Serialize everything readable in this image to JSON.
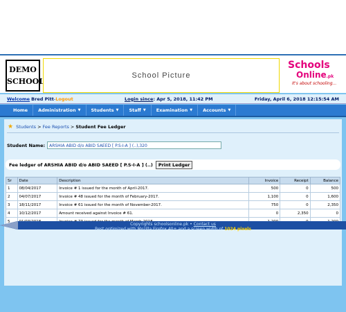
{
  "header": {
    "logo_line1": "DEMO",
    "logo_line2": "SCHOOL",
    "picture_label": "School Picture",
    "brand_schools": "Schools",
    "brand_online": "Online",
    "brand_pk": ".pk",
    "brand_tagline": "It's about schooling..."
  },
  "userbar": {
    "welcome": "Welcome",
    "user": "Bred Pitt",
    "sep": "-",
    "logout": "Logout",
    "login_since_label": "Login since",
    "login_since_value": ": Apr 5, 2018, 11:42 PM",
    "datetime": "Friday, April 6, 2018 12:15:54 AM"
  },
  "nav": [
    {
      "label": "Home",
      "caret": ""
    },
    {
      "label": "Administration",
      "caret": "▼"
    },
    {
      "label": "Students",
      "caret": "▼"
    },
    {
      "label": "Staff",
      "caret": "▼"
    },
    {
      "label": "Examination",
      "caret": "▼"
    },
    {
      "label": "Accounts",
      "caret": "▼"
    }
  ],
  "breadcrumb": {
    "items": [
      "Students",
      "Fee Reports"
    ],
    "separator": ">",
    "current": "Student Fee Ledger"
  },
  "student": {
    "label": "Student Name:",
    "value": "ARSHIA ABID d/o ABID SAEED [ P.S-I-A ] (..),320"
  },
  "ledger": {
    "title": "Fee ledger of ARSHIA ABID d/o ABID SAEED [ P.S-I-A ] (..)",
    "print_label": "Print Ledger",
    "columns": [
      "Sr",
      "Date",
      "Description",
      "Invoice",
      "Receipt",
      "Balance"
    ],
    "rows": [
      [
        "1",
        "08/04/2017",
        "Invoice # 1 issued for the month of April-2017.",
        "500",
        "0",
        "500"
      ],
      [
        "2",
        "04/07/2017",
        "Invoice # 48 issued for the month of February-2017.",
        "1,100",
        "0",
        "1,600"
      ],
      [
        "3",
        "18/11/2017",
        "Invoice # 61 issued for the month of November-2017.",
        "750",
        "0",
        "2,350"
      ],
      [
        "4",
        "10/12/2017",
        "Amount received against Invoice # 61.",
        "0",
        "2,350",
        "0"
      ],
      [
        "5",
        "01/03/2018",
        "Invoice # 73 issued for the month of March-2018.",
        "1,200",
        "0",
        "1,200"
      ]
    ]
  },
  "footer": {
    "copyright": "Copyrights schoolsonline.pk",
    "bullet": "•",
    "contact": "Contact us",
    "best_prefix": "Best optimized with Mozilla Firefox 40+ and a screen width of",
    "best_px": "1024 pixels"
  },
  "colors": {
    "page_bg": "#7ec4f0",
    "nav_bg": "#2b7ad1",
    "panel_bg": "#dff0fb",
    "brand": "#e4007c",
    "footer_band": "#1d4fa3"
  },
  "icons": {
    "breadcrumb": "star-icon",
    "nav_dropdown": "caret-down-icon",
    "footer": "pencil-icon"
  }
}
